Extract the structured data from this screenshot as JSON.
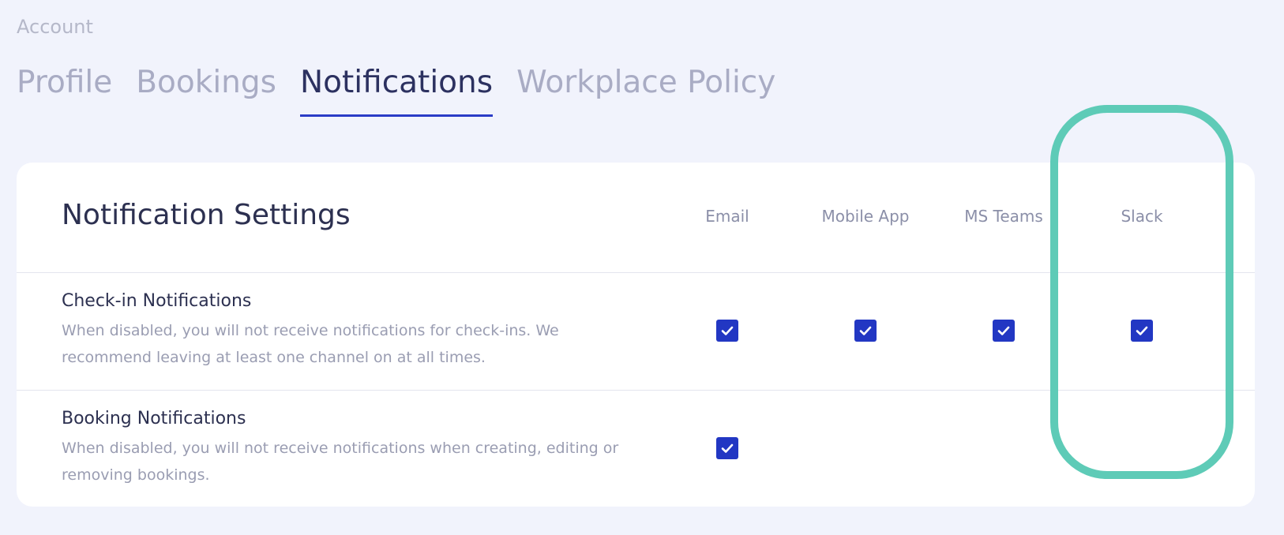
{
  "breadcrumb": "Account",
  "tabs": [
    {
      "label": "Profile",
      "active": false
    },
    {
      "label": "Bookings",
      "active": false
    },
    {
      "label": "Notifications",
      "active": true
    },
    {
      "label": "Workplace Policy",
      "active": false
    }
  ],
  "card": {
    "title": "Notification Settings",
    "columns": [
      "Email",
      "Mobile App",
      "MS Teams",
      "Slack"
    ],
    "rows": [
      {
        "title": "Check-in Notifications",
        "description": "When disabled, you will not receive notifications for check-ins. We recommend leaving at least one channel on at all times.",
        "channels": {
          "email": true,
          "mobile_app": true,
          "ms_teams": true,
          "slack": true
        }
      },
      {
        "title": "Booking Notifications",
        "description": "When disabled, you will not receive notifications when creating, editing or removing bookings.",
        "channels": {
          "email": true,
          "mobile_app": false,
          "ms_teams": false,
          "slack": false
        }
      }
    ]
  },
  "colors": {
    "accent": "#2237c3",
    "highlight": "#5ecbb7",
    "background": "#f1f3fc"
  },
  "icons": {
    "checkbox": "check-icon"
  }
}
